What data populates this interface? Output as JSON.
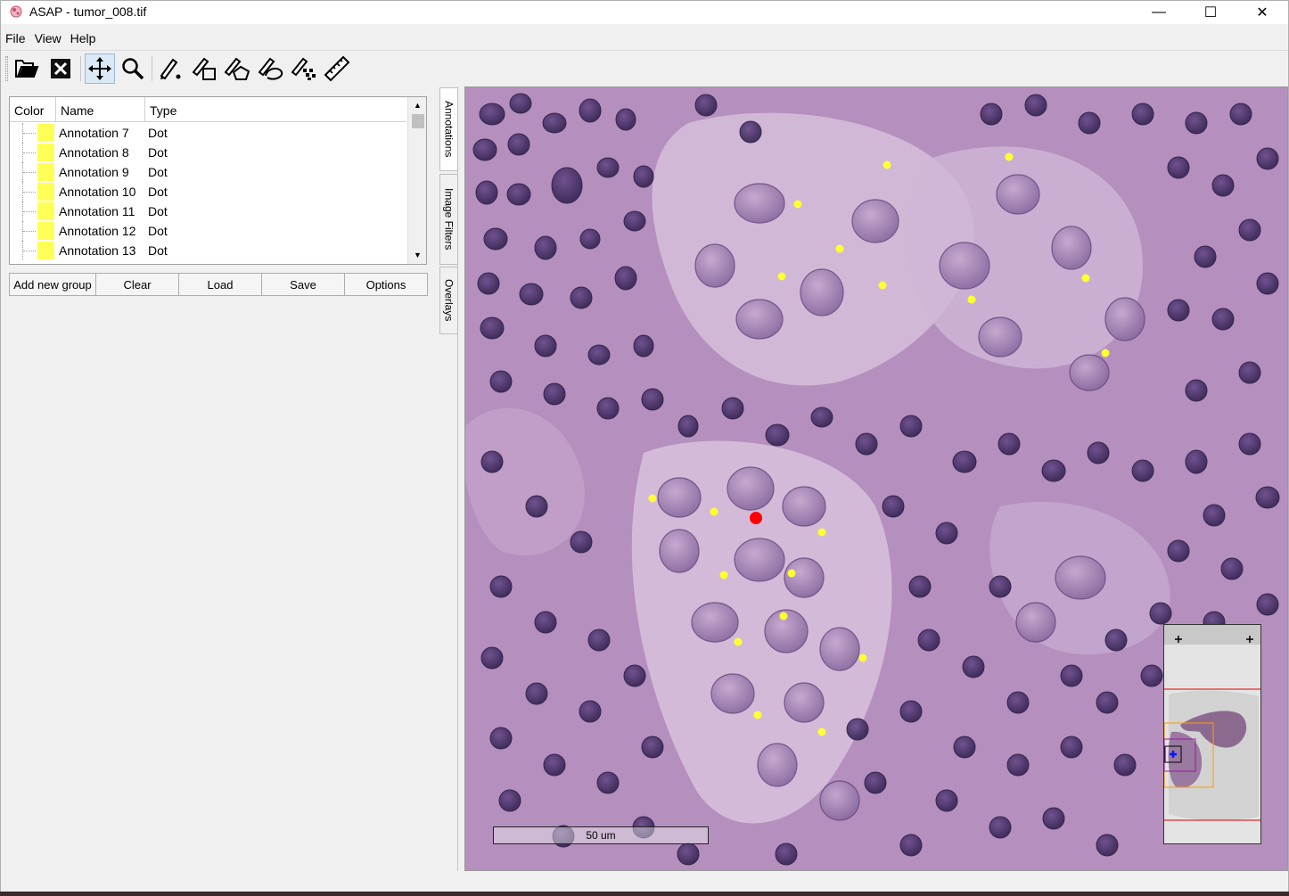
{
  "window": {
    "title": "ASAP - tumor_008.tif",
    "controls": {
      "minimize": "—",
      "maximize": "☐",
      "close": "✕"
    }
  },
  "menu": [
    "File",
    "View",
    "Help"
  ],
  "toolbar": {
    "buttons": [
      {
        "name": "open-icon",
        "active": false
      },
      {
        "name": "close-file-icon",
        "active": false
      },
      {
        "name": "pan-icon",
        "active": true
      },
      {
        "name": "zoom-icon",
        "active": false
      },
      {
        "name": "dot-annotation-icon",
        "active": false
      },
      {
        "name": "rectangle-annotation-icon",
        "active": false
      },
      {
        "name": "polygon-annotation-icon",
        "active": false
      },
      {
        "name": "spline-annotation-icon",
        "active": false
      },
      {
        "name": "pointset-annotation-icon",
        "active": false
      },
      {
        "name": "measurement-icon",
        "active": false
      }
    ]
  },
  "annotations_panel": {
    "columns": [
      "Color",
      "Name",
      "Type"
    ],
    "rows": [
      {
        "name": "Annotation 7",
        "type": "Dot",
        "color": "#ffff55"
      },
      {
        "name": "Annotation 8",
        "type": "Dot",
        "color": "#ffff55"
      },
      {
        "name": "Annotation 9",
        "type": "Dot",
        "color": "#ffff55"
      },
      {
        "name": "Annotation 10",
        "type": "Dot",
        "color": "#ffff55"
      },
      {
        "name": "Annotation 11",
        "type": "Dot",
        "color": "#ffff55"
      },
      {
        "name": "Annotation 12",
        "type": "Dot",
        "color": "#ffff55"
      },
      {
        "name": "Annotation 13",
        "type": "Dot",
        "color": "#ffff55"
      }
    ],
    "buttons": {
      "add_group": "Add new group",
      "clear": "Clear",
      "load": "Load",
      "save": "Save",
      "options": "Options"
    }
  },
  "side_tabs": {
    "annotations": "Annotations",
    "image_filters": "Image Filters",
    "overlays": "Overlays"
  },
  "viewer": {
    "scale_label": "50 um",
    "annotation_color": "#ffff33",
    "selected_color": "#ff0000"
  }
}
